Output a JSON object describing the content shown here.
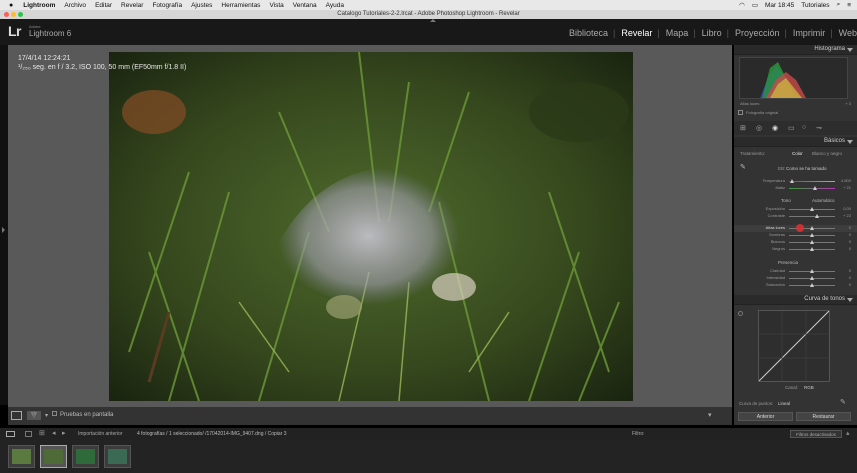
{
  "menubar": {
    "apple": "",
    "items": [
      "Lightroom",
      "Archivo",
      "Editar",
      "Revelar",
      "Fotografía",
      "Ajustes",
      "Herramientas",
      "Vista",
      "Ventana",
      "Ayuda"
    ],
    "clock": "Mar 18:45",
    "user": "Tutoriales"
  },
  "window": {
    "title": "Catalogo Tutoriales-2-2.lrcat - Adobe Photoshop Lightroom - Revelar"
  },
  "app": {
    "logo": "Lr",
    "adobe": "Adobe",
    "product": "Lightroom 6"
  },
  "modules": [
    "Biblioteca",
    "Revelar",
    "Mapa",
    "Libro",
    "Proyección",
    "Imprimir",
    "Web"
  ],
  "active_module": "Revelar",
  "photo_info": {
    "line1": "17/4/14 12:24:21",
    "line2": "¹/₂₅₀ seg. en f / 3.2, ISO 100, 50 mm (EF50mm f/1.8 II)"
  },
  "panel": {
    "histogram": "Histograma",
    "hist_footer_left": "Altas luces",
    "hist_footer_right": "+ 3",
    "original": "Fotografía original",
    "basic": "Básicos",
    "tratamiento": "Tratamiento:",
    "color": "Color",
    "bn": "Blanco y negro",
    "wb_label": "EB:",
    "wb_value": "Como se ha tomado",
    "temp_label": "Temperatura",
    "temp_val": "4.800",
    "tint_label": "Matiz",
    "tint_val": "+ 21",
    "tone_label": "Tono",
    "auto": "Automático",
    "expo_label": "Exposición",
    "expo_val": "0,00",
    "contrast_label": "Contraste",
    "contrast_val": "+ 22",
    "high_label": "Altas luces",
    "high_val": "0",
    "shadows_label": "Sombras",
    "shadows_val": "0",
    "whites_label": "Blancos",
    "whites_val": "0",
    "blacks_label": "Negros",
    "blacks_val": "0",
    "presence": "Presencia",
    "clarity_label": "Claridad",
    "clarity_val": "0",
    "vibrance_label": "Intensidad",
    "vibrance_val": "0",
    "saturation_label": "Saturación",
    "saturation_val": "0",
    "curve": "Curva de tonos",
    "channel_label": "Canal:",
    "channel_val": "RGB",
    "point_curve_label": "Curva de puntos:",
    "point_curve_val": "Lineal",
    "prev": "Anterior",
    "reset": "Restaurar"
  },
  "toolbar": {
    "proof": "Pruebas en pantalla"
  },
  "filmstrip_header": {
    "source": "Importación anterior",
    "info": "4 fotografías / 1 seleccionado/ /17042014-IMG_9407.dng / Copiar 3",
    "filter_label": "Filtro:",
    "filter_value": "Filtros desactivados"
  },
  "colors": {
    "accent": "#ffffff",
    "panel": "#333333",
    "center": "#595959",
    "highlight_marker": "#e03030"
  }
}
